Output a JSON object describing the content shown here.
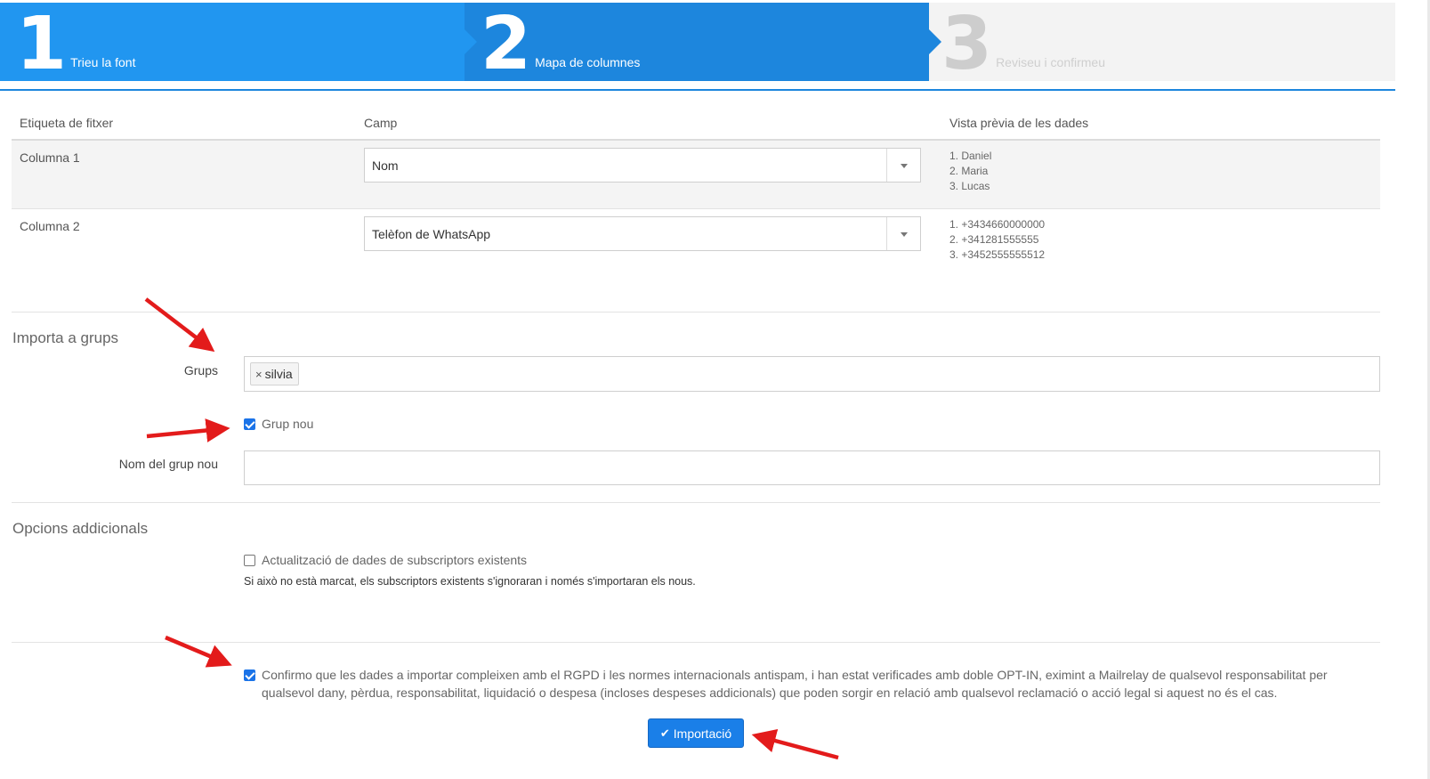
{
  "wizard": {
    "steps": [
      {
        "number": "1",
        "label": "Trieu la font",
        "state": "done"
      },
      {
        "number": "2",
        "label": "Mapa de columnes",
        "state": "active"
      },
      {
        "number": "3",
        "label": "Reviseu i confirmeu",
        "state": "pending"
      }
    ]
  },
  "mapping": {
    "headers": {
      "file_label": "Etiqueta de fitxer",
      "field": "Camp",
      "preview": "Vista prèvia de les dades"
    },
    "rows": [
      {
        "file_label": "Columna 1",
        "field": "Nom",
        "preview": [
          "1. Daniel",
          "2. Maria",
          "3. Lucas"
        ]
      },
      {
        "file_label": "Columna 2",
        "field": "Telèfon de WhatsApp",
        "preview": [
          "1. +3434660000000",
          "2. +341281555555",
          "3. +3452555555512"
        ]
      }
    ]
  },
  "groups": {
    "title": "Importa a grups",
    "groups_label": "Grups",
    "tag_remove": "×",
    "tag": "silvia",
    "new_group_checkbox": "Grup nou",
    "new_group_checked": true,
    "new_group_name_label": "Nom del grup nou",
    "new_group_name_value": ""
  },
  "options": {
    "title": "Opcions addicionals",
    "update_label": "Actualització de dades de subscriptors existents",
    "update_checked": false,
    "update_help": "Si això no està marcat, els subscriptors existents s'ignoraran i només s'importaran els nous."
  },
  "consent": {
    "checked": true,
    "text": "Confirmo que les dades a importar compleixen amb el RGPD i les normes internacionals antispam, i han estat verificades amb doble OPT-IN, eximint a Mailrelay de qualsevol responsabilitat per qualsevol dany, pèrdua, responsabilitat, liquidació o despesa (incloses despeses addicionals) que poden sorgir en relació amb qualsevol reclamació o acció legal si aquest no és el cas."
  },
  "import_button": {
    "label": "Importació",
    "icon": "check-icon"
  },
  "colors": {
    "step1": "#2196f0",
    "step2": "#1d86dd",
    "step3": "#f3f3f3",
    "button": "#1a7fe8",
    "annotation_arrow": "#e31b1b"
  }
}
